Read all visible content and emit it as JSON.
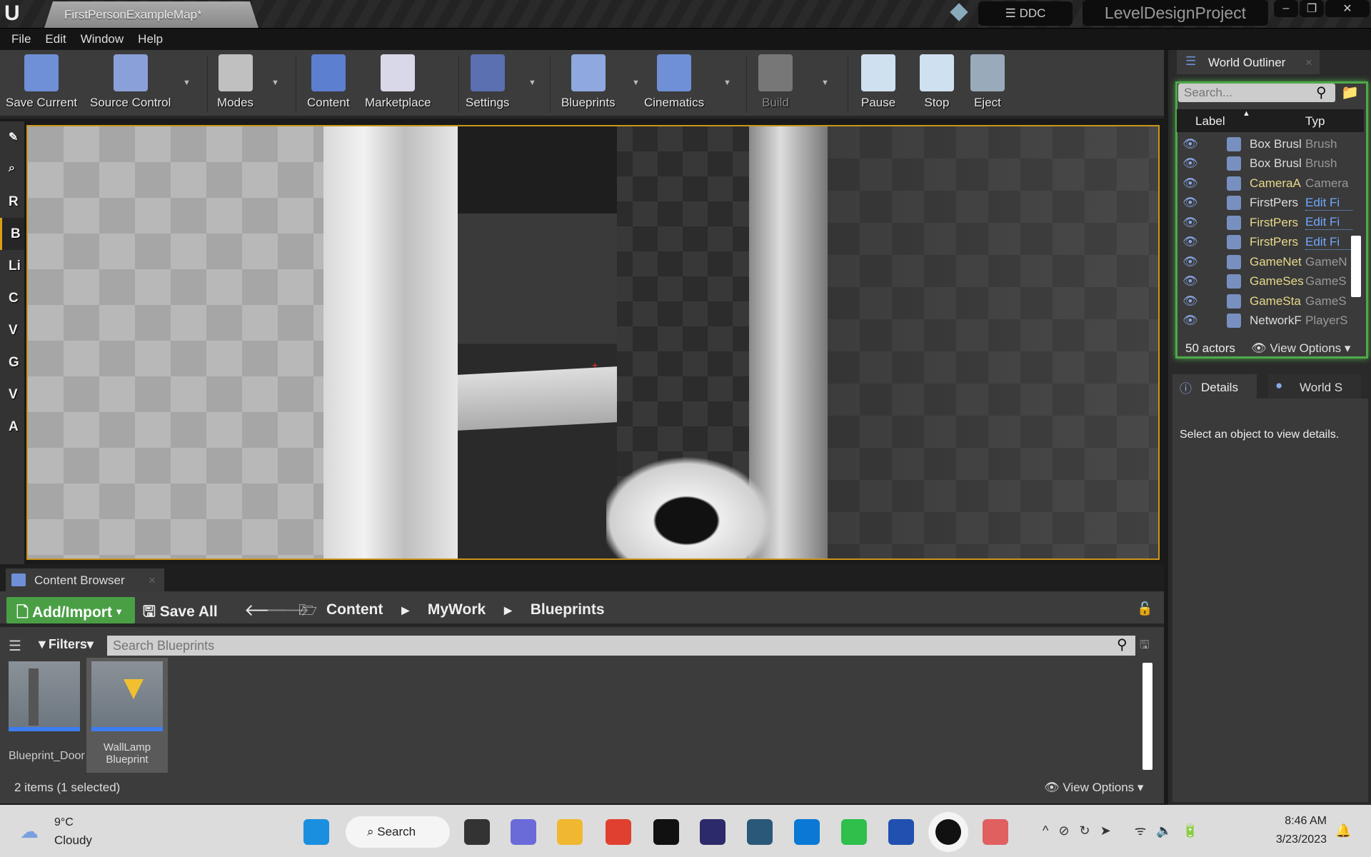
{
  "window": {
    "doc_tab": "FirstPersonExampleMap*",
    "ddc": "DDC",
    "project": "LevelDesignProject",
    "min": "‒",
    "max": "❐",
    "close": "✕"
  },
  "menu": [
    "File",
    "Edit",
    "Window",
    "Help"
  ],
  "toolbar": [
    {
      "label": "Save Current",
      "icon": "save-icon",
      "color": "#6f8fd6"
    },
    {
      "label": "Source Control",
      "icon": "source-control-icon",
      "color": "#8aa0d8"
    },
    {
      "label": "Modes",
      "icon": "modes-icon",
      "color": "#c0c0c0"
    },
    {
      "label": "Content",
      "icon": "content-icon",
      "color": "#5d7fd0"
    },
    {
      "label": "Marketplace",
      "icon": "marketplace-icon",
      "color": "#d8d8e8"
    },
    {
      "label": "Settings",
      "icon": "settings-icon",
      "color": "#5a70b0"
    },
    {
      "label": "Blueprints",
      "icon": "blueprints-icon",
      "color": "#8fa8e0"
    },
    {
      "label": "Cinematics",
      "icon": "cinematics-icon",
      "color": "#6f8fd6"
    },
    {
      "label": "Build",
      "icon": "build-icon",
      "color": "#777"
    },
    {
      "label": "Pause",
      "icon": "pause-icon",
      "color": "#cfe0f0"
    },
    {
      "label": "Stop",
      "icon": "stop-icon",
      "color": "#cfe0f0"
    },
    {
      "label": "Eject",
      "icon": "eject-icon",
      "color": "#9ab"
    }
  ],
  "modes": [
    "R",
    "B",
    "Li",
    "C",
    "V",
    "G",
    "V",
    "A"
  ],
  "outliner": {
    "title": "World Outliner",
    "search_placeholder": "Search...",
    "col_label": "Label",
    "col_type": "Typ",
    "rows": [
      {
        "label": "Box Brusl",
        "type": "Brush",
        "label_color": "#ddd",
        "type_link": false
      },
      {
        "label": "Box Brusl",
        "type": "Brush",
        "label_color": "#ddd",
        "type_link": false
      },
      {
        "label": "CameraA",
        "type": "Camera",
        "label_color": "#e8d98a",
        "type_link": false
      },
      {
        "label": "FirstPers",
        "type": "Edit Fi",
        "label_color": "#ddd",
        "type_link": true
      },
      {
        "label": "FirstPers",
        "type": "Edit Fi",
        "label_color": "#e8d98a",
        "type_link": true
      },
      {
        "label": "FirstPers",
        "type": "Edit Fi",
        "label_color": "#e8d98a",
        "type_link": true
      },
      {
        "label": "GameNet",
        "type": "GameN",
        "label_color": "#e8d98a",
        "type_link": false
      },
      {
        "label": "GameSes",
        "type": "GameS",
        "label_color": "#e8d98a",
        "type_link": false
      },
      {
        "label": "GameSta",
        "type": "GameS",
        "label_color": "#e8d98a",
        "type_link": false
      },
      {
        "label": "NetworkF",
        "type": "PlayerS",
        "label_color": "#ddd",
        "type_link": false
      }
    ],
    "count": "50 actors",
    "view_options": "View Options"
  },
  "details": {
    "tab1": "Details",
    "tab2": "World S",
    "empty": "Select an object to view details."
  },
  "content_browser": {
    "title": "Content Browser",
    "add_import": "Add/Import",
    "save_all": "Save All",
    "breadcrumb": [
      "Content",
      "MyWork",
      "Blueprints"
    ],
    "filters": "Filters",
    "search_placeholder": "Search Blueprints",
    "assets": [
      {
        "name": "Blueprint_Door",
        "selected": false
      },
      {
        "name": "WallLamp Blueprint",
        "selected": true
      }
    ],
    "status": "2 items (1 selected)",
    "view_options": "View Options"
  },
  "taskbar": {
    "temp": "9°C",
    "weather": "Cloudy",
    "search": "Search",
    "time": "8:46 AM",
    "date": "3/23/2023",
    "apps": [
      "windows-start",
      "task-view",
      "teams",
      "file-explorer",
      "chrome",
      "dell",
      "eclipse",
      "mysql-workbench",
      "app-green",
      "whatsapp",
      "word",
      "unreal-engine",
      "snipping-tool"
    ]
  }
}
